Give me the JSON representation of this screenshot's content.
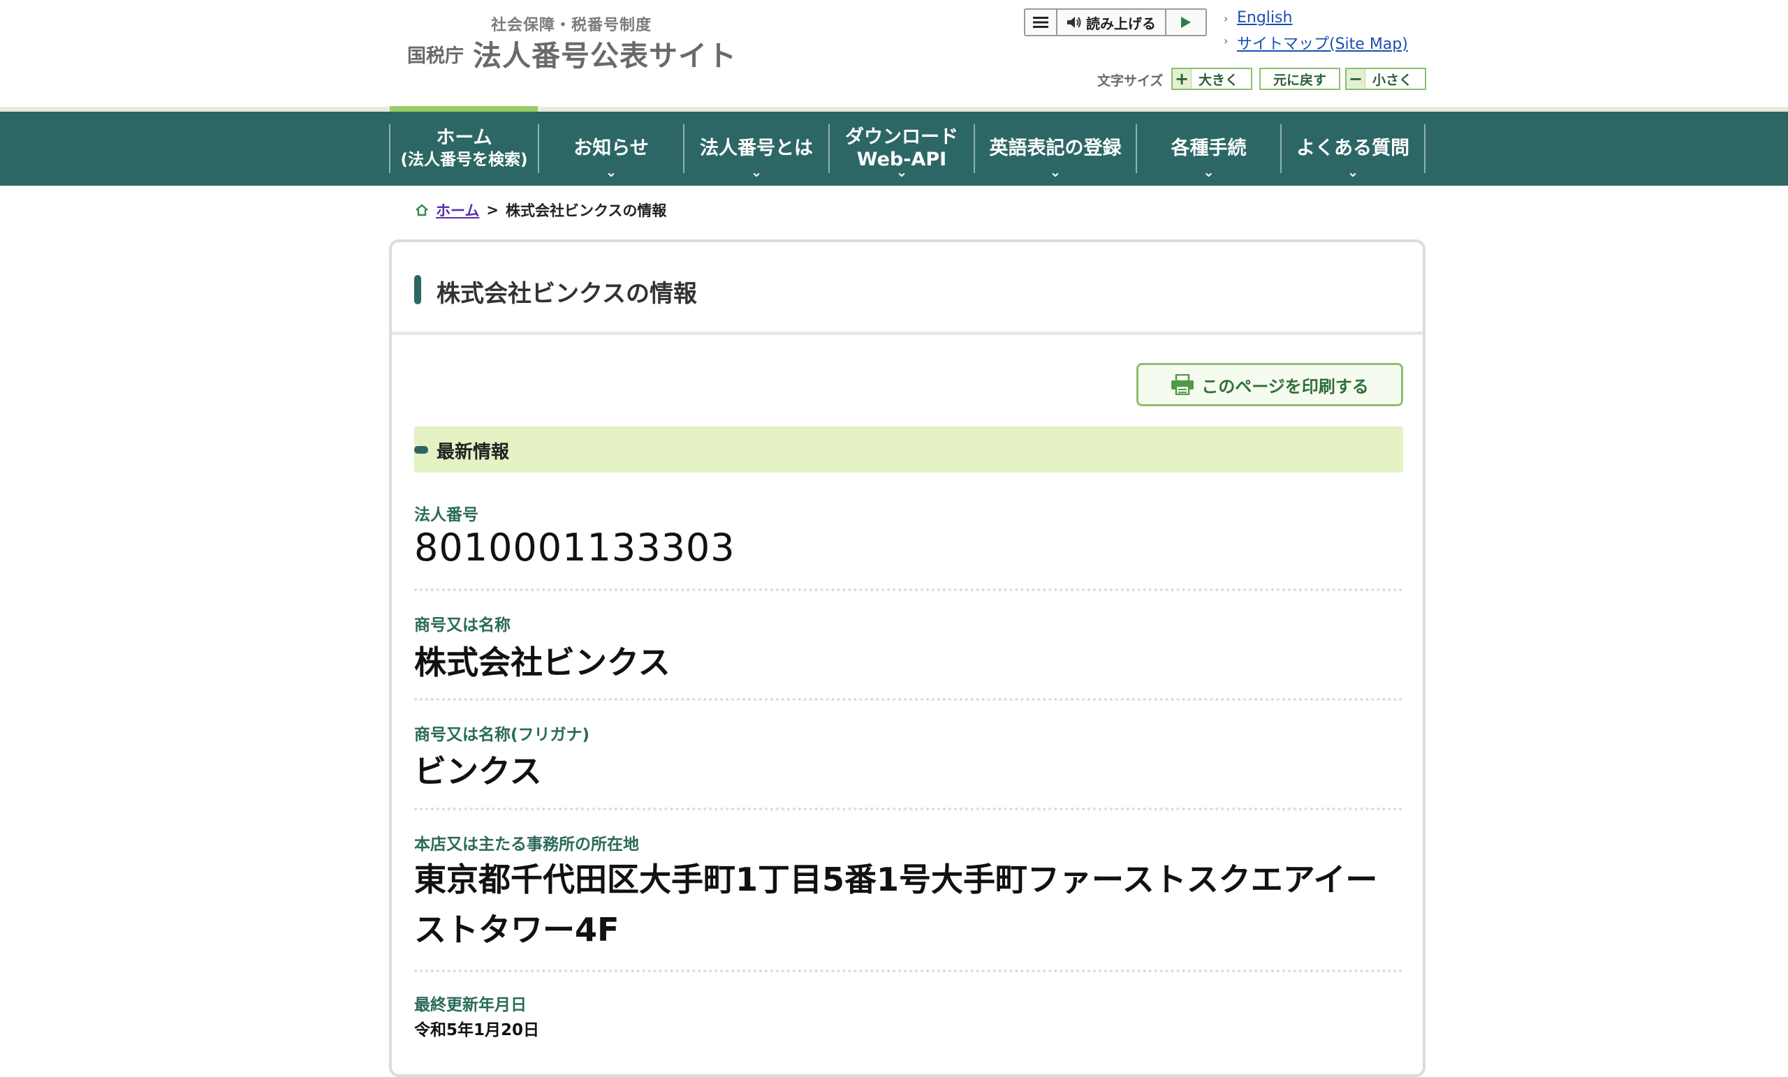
{
  "header": {
    "logo_subtitle": "社会保障・税番号制度",
    "logo_agency": "国税庁",
    "logo_title": "法人番号公表サイト",
    "voice": {
      "read_label": "読み上げる"
    },
    "links": {
      "english": "English",
      "sitemap": "サイトマップ(Site Map)"
    },
    "font_size": {
      "label": "文字サイズ",
      "large": "大きく",
      "reset": "元に戻す",
      "small": "小さく"
    }
  },
  "nav": {
    "items": [
      {
        "line1": "ホーム",
        "line2": "(法人番号を検索)"
      },
      {
        "line1": "お知らせ"
      },
      {
        "line1": "法人番号とは"
      },
      {
        "line1": "ダウンロード",
        "line2": "Web-API"
      },
      {
        "line1": "英語表記の登録"
      },
      {
        "line1": "各種手続"
      },
      {
        "line1": "よくある質問"
      }
    ]
  },
  "breadcrumb": {
    "home": "ホーム",
    "separator": ">",
    "current": "株式会社ビンクスの情報"
  },
  "page": {
    "title": "株式会社ビンクスの情報",
    "print_label": "このページを印刷する",
    "section_label": "最新情報"
  },
  "fields": {
    "number_label": "法人番号",
    "number_value": "8010001133303",
    "name_label": "商号又は名称",
    "name_value": "株式会社ビンクス",
    "kana_label": "商号又は名称(フリガナ)",
    "kana_value": "ビンクス",
    "address_label": "本店又は主たる事務所の所在地",
    "address_value": "東京都千代田区大手町1丁目5番1号大手町ファーストスクエアイーストタワー4F",
    "updated_label": "最終更新年月日",
    "updated_value": "令和5年1月20日"
  },
  "colors": {
    "nav_bg": "#2c6766",
    "accent_green": "#8cc06e",
    "section_bg": "#e4f2c4"
  }
}
